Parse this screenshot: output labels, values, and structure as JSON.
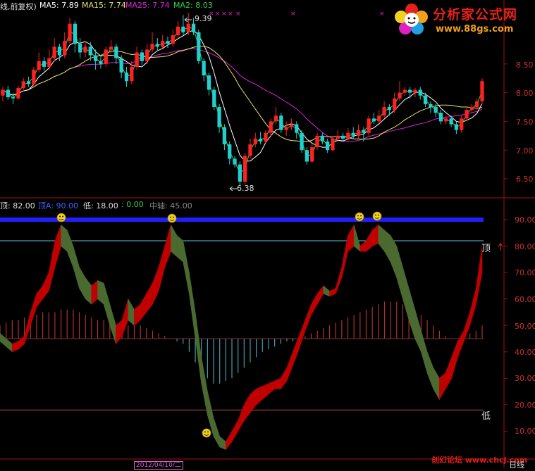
{
  "header": {
    "left": "线,前复权)",
    "ma5": "MA5: 7.89",
    "ma15": "MA15: 7.74",
    "ma25": "MA25: 7.74",
    "ma2": "MA2: 8.03"
  },
  "colors": {
    "ma5": "#ffffff",
    "ma15": "#e6e666",
    "ma25": "#e020e0",
    "ma2": "#36d436",
    "up": "#ff2020",
    "down": "#20d0d0",
    "top_band": "#2020ff",
    "lower_band": "#c05050",
    "axis_red": "#a01010",
    "red_area": "#c00000",
    "green_area": "#4a6a30"
  },
  "price_panel": {
    "ylabels": [
      "8.50",
      "8.00",
      "7.50",
      "7.00",
      "6.50"
    ],
    "yvalues": [
      8.5,
      8.0,
      7.5,
      7.0,
      6.5
    ],
    "high_label": "9.39",
    "low_label": "6.38"
  },
  "indicator_panel": {
    "legend": {
      "top": "顶: 82.00",
      "topA": "顶A: 90.00",
      "low": "低: 18.00",
      "zero": ": 0.00",
      "mid": "中轴: 45.00"
    },
    "ylabels": [
      "90.00",
      "80.00",
      "70.00",
      "60.00",
      "50.00",
      "40.00",
      "30.00",
      "20.00",
      "10.00"
    ],
    "yvalues": [
      90,
      80,
      70,
      60,
      50,
      40,
      30,
      20,
      10
    ],
    "top_tag": "顶",
    "low_tag": "低"
  },
  "logo": {
    "title": "分析家公式网",
    "url": "www.88gs.com"
  },
  "footer": {
    "date_tab": "2012/04/10/二",
    "watermark": "创幻论坛 www.chcj.com",
    "corner": "日线"
  },
  "chart_data": [
    {
      "type": "candlestick",
      "title": "",
      "series": [
        {
          "name": "MA5",
          "value": 7.89
        },
        {
          "name": "MA15",
          "value": 7.74
        },
        {
          "name": "MA25",
          "value": 7.74
        },
        {
          "name": "MA2",
          "value": 8.03
        }
      ],
      "ylim": [
        6.3,
        9.5
      ],
      "yticks": [
        8.5,
        8.0,
        7.5,
        7.0,
        6.5
      ],
      "annotations": [
        {
          "text": "9.39",
          "value": 9.39
        },
        {
          "text": "6.38",
          "value": 6.38
        }
      ],
      "candles": [
        [
          7.95,
          8.05,
          8.1,
          7.85
        ],
        [
          8.05,
          7.92,
          8.12,
          7.88
        ],
        [
          7.92,
          7.9,
          8.0,
          7.8
        ],
        [
          7.9,
          8.08,
          8.12,
          7.88
        ],
        [
          8.08,
          8.2,
          8.25,
          8.02
        ],
        [
          8.2,
          8.15,
          8.28,
          8.1
        ],
        [
          8.15,
          8.4,
          8.45,
          8.12
        ],
        [
          8.4,
          8.55,
          8.7,
          8.35
        ],
        [
          8.55,
          8.45,
          8.62,
          8.38
        ],
        [
          8.45,
          8.6,
          8.75,
          8.4
        ],
        [
          8.6,
          8.8,
          8.95,
          8.55
        ],
        [
          8.8,
          8.65,
          8.85,
          8.55
        ],
        [
          8.65,
          8.9,
          9.05,
          8.6
        ],
        [
          8.9,
          9.2,
          9.3,
          8.85
        ],
        [
          9.2,
          8.85,
          9.25,
          8.7
        ],
        [
          8.85,
          8.7,
          8.95,
          8.6
        ],
        [
          8.7,
          8.8,
          8.9,
          8.62
        ],
        [
          8.8,
          8.65,
          8.88,
          8.55
        ],
        [
          8.65,
          8.55,
          8.75,
          8.4
        ],
        [
          8.55,
          8.5,
          8.65,
          8.42
        ],
        [
          8.5,
          8.75,
          8.8,
          8.45
        ],
        [
          8.75,
          8.8,
          8.92,
          8.68
        ],
        [
          8.8,
          8.6,
          8.85,
          8.5
        ],
        [
          8.6,
          8.35,
          8.65,
          8.25
        ],
        [
          8.35,
          8.2,
          8.45,
          8.1
        ],
        [
          8.2,
          8.45,
          8.55,
          8.15
        ],
        [
          8.45,
          8.7,
          8.8,
          8.4
        ],
        [
          8.7,
          8.55,
          8.75,
          8.48
        ],
        [
          8.55,
          8.75,
          8.85,
          8.5
        ],
        [
          8.75,
          8.85,
          9.05,
          8.7
        ],
        [
          8.85,
          8.8,
          8.95,
          8.72
        ],
        [
          8.8,
          8.9,
          9.0,
          8.78
        ],
        [
          8.9,
          8.85,
          8.98,
          8.78
        ],
        [
          8.85,
          9.0,
          9.1,
          8.8
        ],
        [
          9.0,
          9.15,
          9.25,
          8.95
        ],
        [
          9.15,
          9.05,
          9.35,
          9.0
        ],
        [
          9.05,
          9.2,
          9.39,
          9.0
        ],
        [
          9.2,
          9.05,
          9.3,
          9.0
        ],
        [
          9.05,
          8.55,
          9.1,
          8.5
        ],
        [
          8.55,
          8.3,
          8.6,
          8.2
        ],
        [
          8.3,
          8.05,
          8.35,
          7.95
        ],
        [
          8.05,
          7.75,
          8.1,
          7.7
        ],
        [
          7.75,
          7.4,
          7.8,
          7.3
        ],
        [
          7.4,
          7.1,
          7.45,
          7.0
        ],
        [
          7.1,
          6.85,
          7.15,
          6.75
        ],
        [
          6.85,
          6.75,
          6.9,
          6.7
        ],
        [
          6.75,
          6.45,
          6.8,
          6.38
        ],
        [
          6.45,
          6.9,
          6.95,
          6.4
        ],
        [
          6.9,
          7.1,
          7.2,
          6.85
        ],
        [
          7.1,
          7.2,
          7.3,
          7.05
        ],
        [
          7.2,
          7.15,
          7.32,
          7.1
        ],
        [
          7.15,
          7.3,
          7.35,
          7.12
        ],
        [
          7.3,
          7.5,
          7.55,
          7.25
        ],
        [
          7.5,
          7.6,
          7.75,
          7.45
        ],
        [
          7.6,
          7.35,
          7.65,
          7.3
        ],
        [
          7.35,
          7.4,
          7.5,
          7.25
        ],
        [
          7.4,
          7.45,
          7.55,
          7.35
        ],
        [
          7.45,
          7.3,
          7.5,
          7.2
        ],
        [
          7.3,
          7.0,
          7.35,
          6.95
        ],
        [
          7.0,
          6.8,
          7.05,
          6.75
        ],
        [
          6.8,
          7.05,
          7.1,
          6.78
        ],
        [
          7.05,
          7.25,
          7.3,
          7.0
        ],
        [
          7.25,
          7.15,
          7.3,
          7.1
        ],
        [
          7.15,
          7.0,
          7.2,
          6.95
        ],
        [
          7.0,
          7.2,
          7.25,
          6.98
        ],
        [
          7.2,
          7.25,
          7.35,
          7.15
        ],
        [
          7.25,
          7.2,
          7.3,
          7.15
        ],
        [
          7.2,
          7.3,
          7.38,
          7.18
        ],
        [
          7.3,
          7.25,
          7.4,
          7.2
        ],
        [
          7.25,
          7.35,
          7.45,
          7.2
        ],
        [
          7.35,
          7.3,
          7.4,
          7.15
        ],
        [
          7.3,
          7.55,
          7.6,
          7.25
        ],
        [
          7.55,
          7.5,
          7.65,
          7.45
        ],
        [
          7.5,
          7.6,
          7.7,
          7.48
        ],
        [
          7.6,
          7.75,
          7.85,
          7.55
        ],
        [
          7.75,
          7.7,
          7.8,
          7.6
        ],
        [
          7.7,
          7.9,
          8.0,
          7.65
        ],
        [
          7.9,
          8.0,
          8.2,
          7.85
        ],
        [
          8.0,
          8.05,
          8.1,
          7.95
        ],
        [
          8.05,
          8.0,
          8.1,
          7.9
        ],
        [
          8.0,
          8.05,
          8.08,
          7.92
        ],
        [
          8.05,
          7.95,
          8.1,
          7.88
        ],
        [
          7.95,
          7.8,
          8.0,
          7.75
        ],
        [
          7.8,
          7.75,
          7.85,
          7.65
        ],
        [
          7.75,
          7.65,
          7.8,
          7.58
        ],
        [
          7.65,
          7.5,
          7.7,
          7.45
        ],
        [
          7.5,
          7.55,
          7.6,
          7.45
        ],
        [
          7.55,
          7.45,
          7.6,
          7.4
        ],
        [
          7.45,
          7.35,
          7.5,
          7.28
        ],
        [
          7.35,
          7.55,
          7.6,
          7.3
        ],
        [
          7.55,
          7.7,
          7.75,
          7.5
        ],
        [
          7.7,
          7.75,
          7.8,
          7.65
        ],
        [
          7.75,
          7.85,
          7.9,
          7.7
        ],
        [
          7.85,
          8.2,
          8.25,
          7.8
        ]
      ]
    },
    {
      "type": "area",
      "title": "",
      "ylim": [
        0,
        100
      ],
      "yticks": [
        90,
        80,
        70,
        60,
        50,
        40,
        30,
        20,
        10
      ],
      "lines": {
        "顶": 82,
        "顶A": 90,
        "低": 18,
        "中轴": 45
      },
      "upper": [
        47,
        45,
        43,
        44,
        46,
        55,
        62,
        65,
        70,
        82,
        88,
        86,
        80,
        72,
        68,
        65,
        67,
        66,
        58,
        50,
        52,
        60,
        56,
        58,
        62,
        66,
        72,
        80,
        88,
        84,
        82,
        70,
        55,
        38,
        25,
        15,
        8,
        6,
        10,
        14,
        20,
        24,
        26,
        27,
        28,
        29,
        30,
        34,
        40,
        46,
        52,
        58,
        62,
        65,
        63,
        64,
        72,
        84,
        88,
        80,
        82,
        86,
        88,
        86,
        84,
        80,
        72,
        64,
        56,
        48,
        40,
        34,
        30,
        32,
        38,
        44,
        48,
        55,
        64,
        80
      ],
      "lower": [
        44,
        42,
        40,
        41,
        43,
        50,
        57,
        60,
        63,
        72,
        80,
        78,
        72,
        64,
        60,
        58,
        60,
        58,
        50,
        43,
        46,
        52,
        50,
        52,
        55,
        58,
        63,
        72,
        78,
        76,
        74,
        62,
        45,
        28,
        16,
        8,
        4,
        3,
        6,
        10,
        14,
        17,
        20,
        22,
        24,
        26,
        26,
        29,
        35,
        41,
        48,
        54,
        58,
        62,
        61,
        62,
        68,
        78,
        80,
        78,
        78,
        80,
        81,
        78,
        74,
        68,
        60,
        52,
        45,
        40,
        32,
        26,
        22,
        26,
        30,
        38,
        44,
        50,
        58,
        70
      ],
      "bars": [
        50,
        51,
        52,
        52,
        53,
        54,
        54,
        55,
        55,
        55,
        56,
        56,
        56,
        55,
        54,
        53,
        52,
        52,
        51,
        50,
        50,
        50,
        50,
        50,
        49,
        48,
        47,
        46,
        45,
        44,
        43,
        40,
        36,
        32,
        30,
        28,
        28,
        29,
        30,
        32,
        34,
        36,
        38,
        40,
        41,
        42,
        43,
        44,
        44,
        45,
        46,
        47,
        48,
        49,
        50,
        51,
        52,
        53,
        54,
        55,
        56,
        57,
        58,
        59,
        59,
        59,
        58,
        57,
        56,
        54,
        52,
        50,
        48,
        46,
        45,
        45,
        46,
        47,
        48,
        50
      ]
    }
  ]
}
